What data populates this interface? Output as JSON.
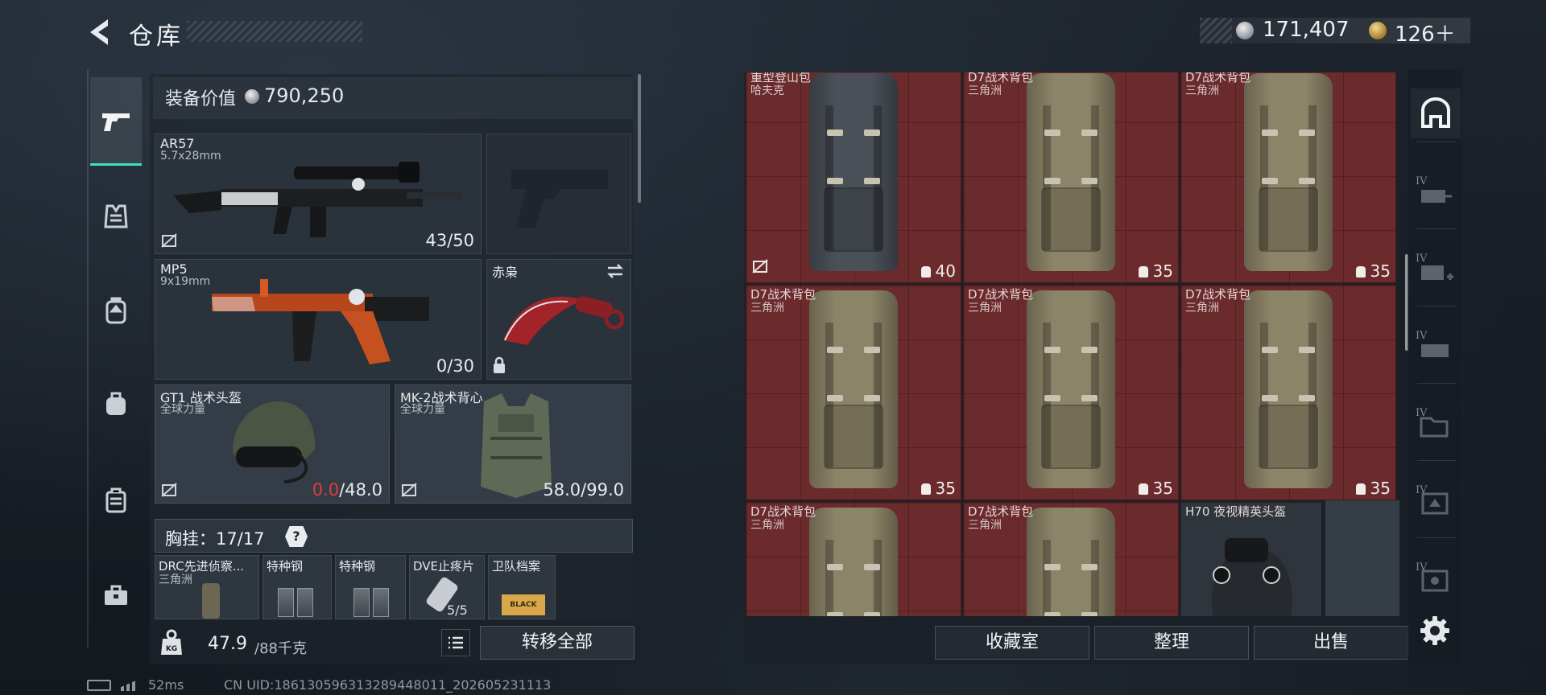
{
  "header": {
    "title": "仓库",
    "currency": {
      "silver": "171,407",
      "gold": "126＋"
    }
  },
  "equipment": {
    "value_label": "装备价值",
    "value": "790,250",
    "slots": {
      "ar57": {
        "name": "AR57",
        "sub": "5.7x28mm",
        "count": "43/50"
      },
      "mp5": {
        "name": "MP5",
        "sub": "9x19mm",
        "count": "0/30"
      },
      "knife": {
        "name": "赤枭"
      },
      "helmet": {
        "name": "GT1 战术头盔",
        "sub": "全球力量",
        "durability_current": "0.0",
        "durability_max": "/48.0"
      },
      "vest": {
        "name": "MK-2战术背心",
        "sub": "全球力量",
        "count": "58.0/99.0"
      }
    },
    "chest_rig": {
      "label": "胸挂：",
      "count": "17/17",
      "help": "?"
    },
    "chest_items": [
      {
        "name": "DRC先进侦察...",
        "sub": "三角洲"
      },
      {
        "name": "特种钢"
      },
      {
        "name": "特种钢"
      },
      {
        "name": "DVE止疼片",
        "count": "5/5"
      },
      {
        "name": "卫队档案",
        "tag": "BLACK TIDE"
      }
    ],
    "weight": {
      "value": "47.9",
      "max": "/88千克",
      "icon_label": "KG"
    },
    "transfer_all": "转移全部"
  },
  "storage": {
    "cells": [
      {
        "name": "重型登山包",
        "sub": "哈夫克",
        "cap": "40",
        "color": "#4a5058",
        "locked": true
      },
      {
        "name": "D7战术背包",
        "sub": "三角洲",
        "cap": "35",
        "color": "#8c8468"
      },
      {
        "name": "D7战术背包",
        "sub": "三角洲",
        "cap": "35",
        "color": "#8c8468"
      },
      {
        "name": "D7战术背包",
        "sub": "三角洲",
        "cap": "35",
        "color": "#8c8468"
      },
      {
        "name": "D7战术背包",
        "sub": "三角洲",
        "cap": "35",
        "color": "#8c8468"
      },
      {
        "name": "D7战术背包",
        "sub": "三角洲",
        "cap": "35",
        "color": "#8c8468"
      },
      {
        "name": "D7战术背包",
        "sub": "三角洲",
        "cap": "",
        "color": "#8c8468"
      },
      {
        "name": "D7战术背包",
        "sub": "三角洲",
        "cap": "",
        "color": "#8c8468"
      },
      {
        "name": "H70 夜视精英头盔",
        "sub": "",
        "cap": "",
        "color": "#26292e",
        "helmet": true
      }
    ],
    "actions": {
      "vault": "收藏室",
      "sort": "整理",
      "sell": "出售"
    },
    "tiers": [
      "IV",
      "IV",
      "IV",
      "IV",
      "IV",
      "IV"
    ]
  },
  "footer": {
    "ping": "52ms",
    "uid": "CN UID:186130596313289448011_202605231113"
  },
  "colors": {
    "accent": "#3fe0c2",
    "durability_zero": "#e03a3a",
    "storage_cell": "#6b2a2c"
  }
}
